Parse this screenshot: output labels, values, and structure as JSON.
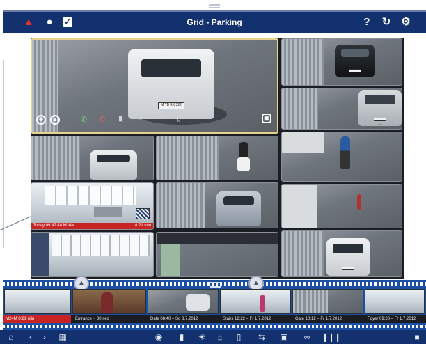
{
  "header": {
    "title": "Grid - Parking",
    "icons": [
      "alarm-icon",
      "chat-bubble-icon",
      "checkbox-icon",
      "help-icon",
      "reload-icon",
      "gear-icon"
    ],
    "help_label": "?"
  },
  "cameras": {
    "main_plate": "M TB EK 322",
    "main_controls": [
      "add-icon",
      "ptz-icon",
      "phone-accept-icon",
      "phone-hangup-icon",
      "door-icon",
      "light-icon",
      "bell-icon",
      "thermometer-icon",
      "screenshot-icon"
    ],
    "office_bar_left": "Today 09:42:48  M24M",
    "office_bar_right": "8:21 min",
    "rear_plate": "MTB EK 322"
  },
  "timeline": {
    "labels": [
      "M24M  8:21 min",
      "Entrance ~ 30 sec",
      "Date 08:40 – So 3.7.2012",
      "Stairs 12:22 – Fr 1.7.2012",
      "Gate 10:12 – Fr 1.7.2012",
      "Foyer 09:20 – Fr 1.7.2012"
    ],
    "accent": "#1b4fa3",
    "rec_color": "#c82424"
  },
  "toolbar": {
    "icons": [
      "home-icon",
      "back-icon",
      "forward-icon",
      "grid-icon",
      "ptz-knob-icon",
      "door-icon",
      "light-icon",
      "light-off-icon",
      "thermometer-icon",
      "swap-icon",
      "snapshot-icon",
      "link-icon",
      "barcode-icon",
      "lock-icon"
    ]
  }
}
